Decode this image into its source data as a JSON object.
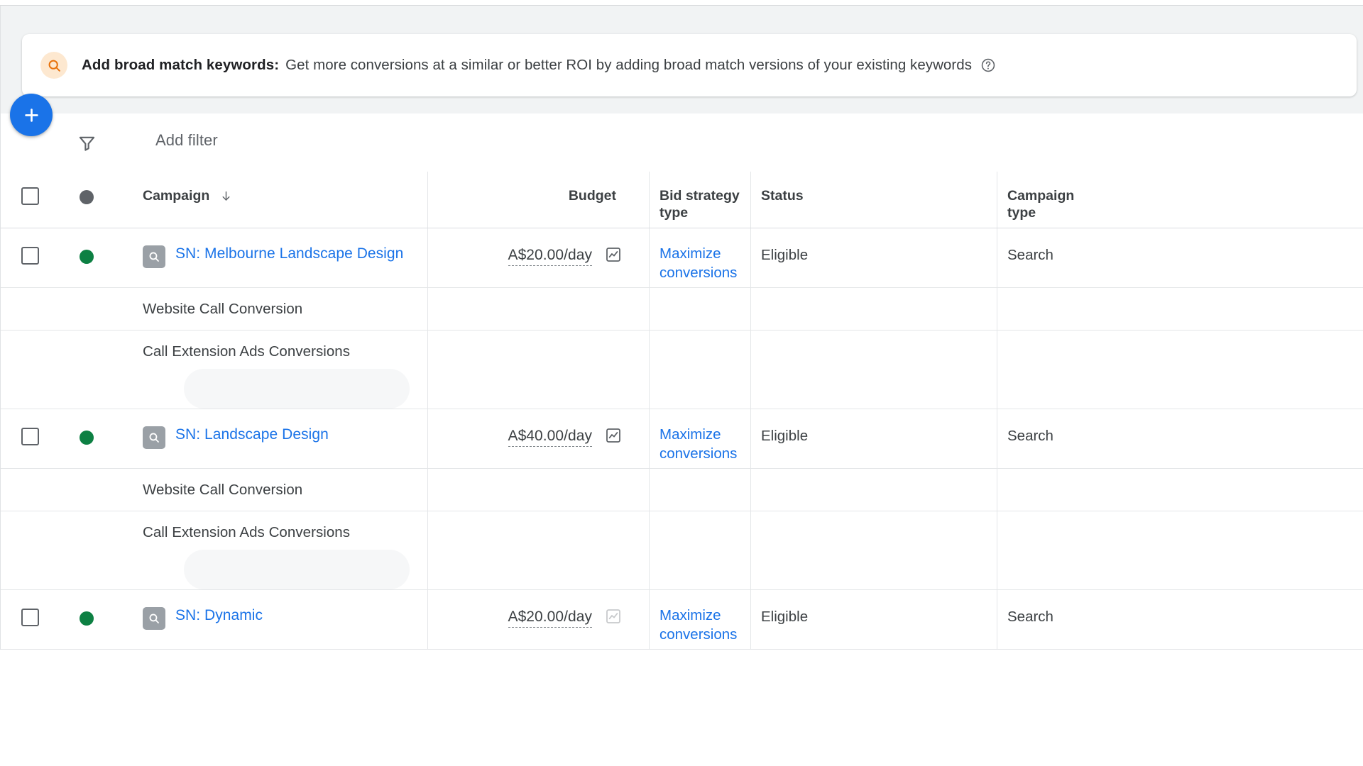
{
  "banner": {
    "icon": "search-icon",
    "title": "Add broad match keywords:",
    "description": "Get more conversions at a similar or better ROI by adding broad match versions of your existing keywords",
    "help_icon": "help-circle-icon",
    "icon_bg": "#fde8d0",
    "icon_color": "#e8710a"
  },
  "toolbar": {
    "add_button": "+",
    "add_button_color": "#1a73e8",
    "filter_icon": "funnel-icon",
    "add_filter_label": "Add filter"
  },
  "table": {
    "headers": {
      "campaign": "Campaign",
      "budget": "Budget",
      "bid_strategy_type": "Bid strategy\ntype",
      "bid_strategy_type_line1": "Bid strategy",
      "bid_strategy_type_line2": "type",
      "status": "Status",
      "campaign_type_line1": "Campaign",
      "campaign_type_line2": "type"
    },
    "sort": {
      "column": "Campaign",
      "direction": "descending",
      "icon": "arrow-down-icon"
    },
    "header_status_dot_color": "#5f6368",
    "row_status_dot_color": "#0d8043",
    "rows": [
      {
        "name": "SN: Melbourne Landscape Design",
        "name_line1": "SN: Melbourne Landscape",
        "name_line2": "Design",
        "type_icon": "search-campaign-icon",
        "status_dot": "green",
        "budget": "A$20.00/day",
        "budget_chart_icon": "chart-icon",
        "budget_chart_enabled": true,
        "bid_strategy_line1": "Maximize",
        "bid_strategy_line2": "conversions",
        "status": "Eligible",
        "campaign_type": "Search",
        "conversions": [
          "Website Call Conversion",
          "Call Extension Ads Conversions"
        ]
      },
      {
        "name": "SN: Landscape Design",
        "name_line1": "SN: Landscape Design",
        "name_line2": "",
        "type_icon": "search-campaign-icon",
        "status_dot": "green",
        "budget": "A$40.00/day",
        "budget_chart_icon": "chart-icon",
        "budget_chart_enabled": true,
        "bid_strategy_line1": "Maximize",
        "bid_strategy_line2": "conversions",
        "status": "Eligible",
        "campaign_type": "Search",
        "conversions": [
          "Website Call Conversion",
          "Call Extension Ads Conversions"
        ]
      },
      {
        "name": "SN: Dynamic",
        "name_line1": "SN: Dynamic",
        "name_line2": "",
        "type_icon": "search-campaign-icon",
        "status_dot": "green",
        "budget": "A$20.00/day",
        "budget_chart_icon": "chart-icon",
        "budget_chart_enabled": false,
        "bid_strategy_line1": "Maximize",
        "bid_strategy_line2": "conversions",
        "status": "Eligible",
        "campaign_type": "Search",
        "conversions": []
      }
    ]
  },
  "colors": {
    "link": "#1a73e8",
    "text": "#3c4043",
    "muted": "#5f6368",
    "green": "#0d8043",
    "border": "#e4e6e8",
    "banner_bg": "#f1f3f4"
  }
}
